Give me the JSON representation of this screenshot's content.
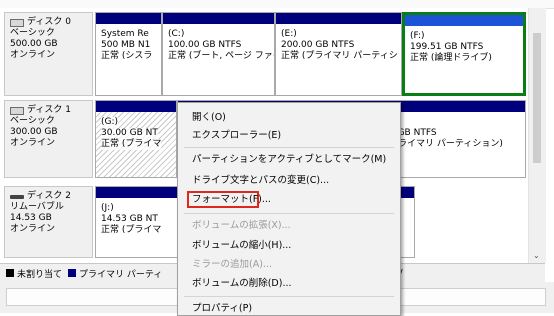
{
  "disks": [
    {
      "name": "ディスク 0",
      "type": "ベーシック",
      "size": "500.00 GB",
      "status": "オンライン",
      "partitions": [
        {
          "title": "System Re",
          "size": "500 MB N1",
          "status": "正常 (シスラ"
        },
        {
          "title": "(C:)",
          "size": "100.00 GB NTFS",
          "status": "正常 (ブート, ページ ファイ,"
        },
        {
          "title": "(E:)",
          "size": "200.00 GB NTFS",
          "status": "正常 (プライマリ パーティシ"
        },
        {
          "title": "(F:)",
          "size": "199.51 GB NTFS",
          "status": "正常 (論理ドライブ)"
        }
      ]
    },
    {
      "name": "ディスク 1",
      "type": "ベーシック",
      "size": "300.00 GB",
      "status": "オンライン",
      "partitions": [
        {
          "title": "(G:)",
          "size": "30.00 GB NT",
          "status": "正常 (プライマ"
        },
        {
          "title": "",
          "size": "0 GB NTFS",
          "status": "プライマリ パーティション)"
        }
      ]
    },
    {
      "name": "ディスク 2",
      "type": "リムーバブル",
      "size": "14.53 GB",
      "status": "オンライン",
      "partitions": [
        {
          "title": "(J:)",
          "size": "14.53 GB NT",
          "status": "正常 (プライマ"
        }
      ]
    }
  ],
  "legend": {
    "unallocated": "未割り当て",
    "primary": "プライマリ パーティ",
    "tail": "ブ"
  },
  "context_menu": {
    "open": "開く(O)",
    "explore": "エクスプローラー(E)",
    "mark_active": "パーティションをアクティブとしてマーク(M)",
    "change_letter": "ドライブ文字とパスの変更(C)...",
    "format": "フォーマット(F)...",
    "extend": "ボリュームの拡張(X)...",
    "shrink": "ボリュームの縮小(H)...",
    "add_mirror": "ミラーの追加(A)...",
    "delete": "ボリュームの削除(D)...",
    "properties": "プロパティ(P)"
  },
  "colors": {
    "primary_bar": "#00007d",
    "logical_bar": "#1d53d6",
    "selected_border": "#0a7e12",
    "highlight_box": "#e0281a"
  }
}
